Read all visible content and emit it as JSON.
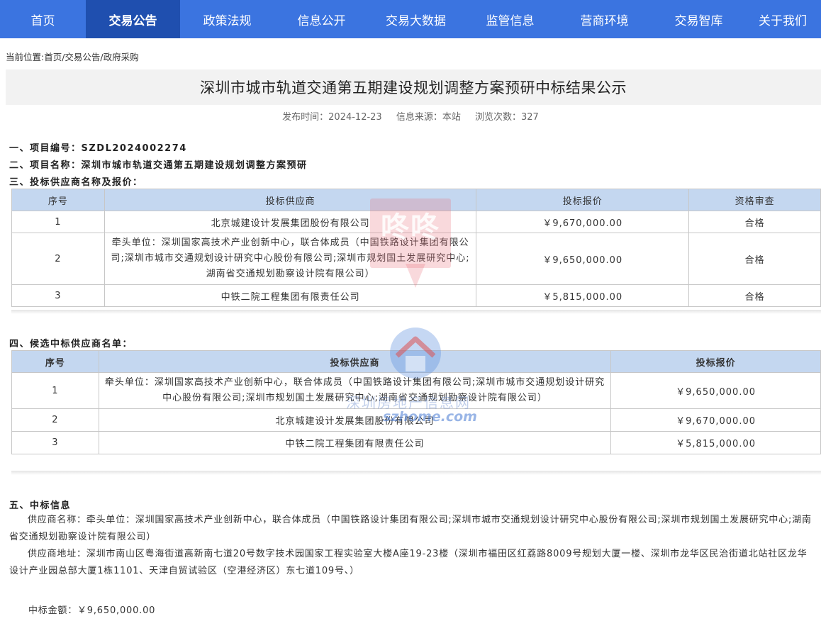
{
  "nav": [
    {
      "label": "首页",
      "active": false
    },
    {
      "label": "交易公告",
      "active": true
    },
    {
      "label": "政策法规",
      "active": false
    },
    {
      "label": "信息公开",
      "active": false
    },
    {
      "label": "交易大数据",
      "active": false
    },
    {
      "label": "监管信息",
      "active": false
    },
    {
      "label": "营商环境",
      "active": false
    },
    {
      "label": "交易智库",
      "active": false
    },
    {
      "label": "关于我们",
      "active": false
    }
  ],
  "breadcrumb": "当前位置:首页/交易公告/政府采购",
  "title": "深圳市城市轨道交通第五期建设规划调整方案预研中标结果公示",
  "meta": {
    "publish": "发布时间：2024-12-23",
    "source": "信息来源：本站",
    "views": "浏览次数：327"
  },
  "sections": {
    "s1": "一、项目编号：SZDL2024002274",
    "s2": "二、项目名称：深圳市城市轨道交通第五期建设规划调整方案预研",
    "s3": "三、投标供应商名称及报价：",
    "s4": "四、候选中标供应商名单：",
    "s5": "五、中标信息"
  },
  "bids": {
    "headers": [
      "序号",
      "投标供应商",
      "投标报价",
      "资格审查"
    ],
    "rows": [
      [
        "1",
        "北京城建设计发展集团股份有限公司",
        "￥9,670,000.00",
        "合格"
      ],
      [
        "2",
        "牵头单位：深圳国家高技术产业创新中心，联合体成员（中国铁路设计集团有限公司;深圳市城市交通规划设计研究中心股份有限公司;深圳市规划国土发展研究中心;湖南省交通规划勘察设计院有限公司）",
        "￥9,650,000.00",
        "合格"
      ],
      [
        "3",
        "中铁二院工程集团有限责任公司",
        "￥5,815,000.00",
        "合格"
      ]
    ]
  },
  "candidates": {
    "headers": [
      "序号",
      "投标供应商",
      "投标报价"
    ],
    "rows": [
      [
        "1",
        "牵头单位：深圳国家高技术产业创新中心，联合体成员（中国铁路设计集团有限公司;深圳市城市交通规划设计研究中心股份有限公司;深圳市规划国土发展研究中心;湖南省交通规划勘察设计院有限公司）",
        "￥9,650,000.00"
      ],
      [
        "2",
        "北京城建设计发展集团股份有限公司",
        "￥9,670,000.00"
      ],
      [
        "3",
        "中铁二院工程集团有限责任公司",
        "￥5,815,000.00"
      ]
    ]
  },
  "award": {
    "supplier": "供应商名称：牵头单位：深圳国家高技术产业创新中心，联合体成员（中国铁路设计集团有限公司;深圳市城市交通规划设计研究中心股份有限公司;深圳市规划国土发展研究中心;湖南省交通规划勘察设计院有限公司）",
    "address": "供应商地址：深圳市南山区粤海街道高新南七道20号数字技术园国家工程实验室大楼A座19-23楼（深圳市福田区红荔路8009号规划大厦一楼、深圳市龙华区民治街道北站社区龙华设计产业园总部大厦1栋1101、天津自贸试验区（空港经济区）东七道109号、）",
    "amount": "中标金额：￥9,650,000.00"
  },
  "watermarks": {
    "stamp": "咚咚",
    "site_cn": "深圳房地产信息网",
    "site_en": "szhome.com"
  },
  "colors": {
    "nav_bg": "#3b74e0",
    "nav_active": "#1f4faf",
    "table_header": "#c4d7f0"
  }
}
